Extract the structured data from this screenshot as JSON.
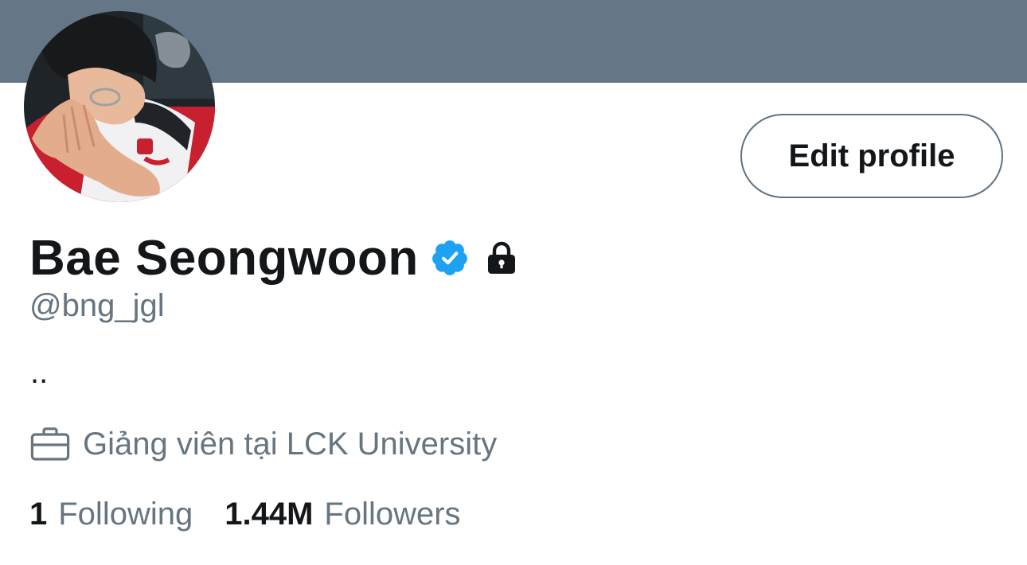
{
  "colors": {
    "banner": "#657786",
    "text_primary": "#14171a",
    "text_secondary": "#66757f",
    "verified": "#1da1f2",
    "button_border": "#5f7281"
  },
  "banner": {
    "icon": "banner-image"
  },
  "avatar": {
    "icon": "profile-photo"
  },
  "edit_profile_label": "Edit profile",
  "profile": {
    "display_name": "Bae Seongwoon",
    "verified_icon": "verified-badge-icon",
    "protected_icon": "lock-icon",
    "handle": "@bng_jgl",
    "bio": "..",
    "job_icon": "briefcase-icon",
    "job": "Giảng viên tại LCK University"
  },
  "stats": {
    "following_count": "1",
    "following_label": "Following",
    "followers_count": "1.44M",
    "followers_label": "Followers"
  }
}
